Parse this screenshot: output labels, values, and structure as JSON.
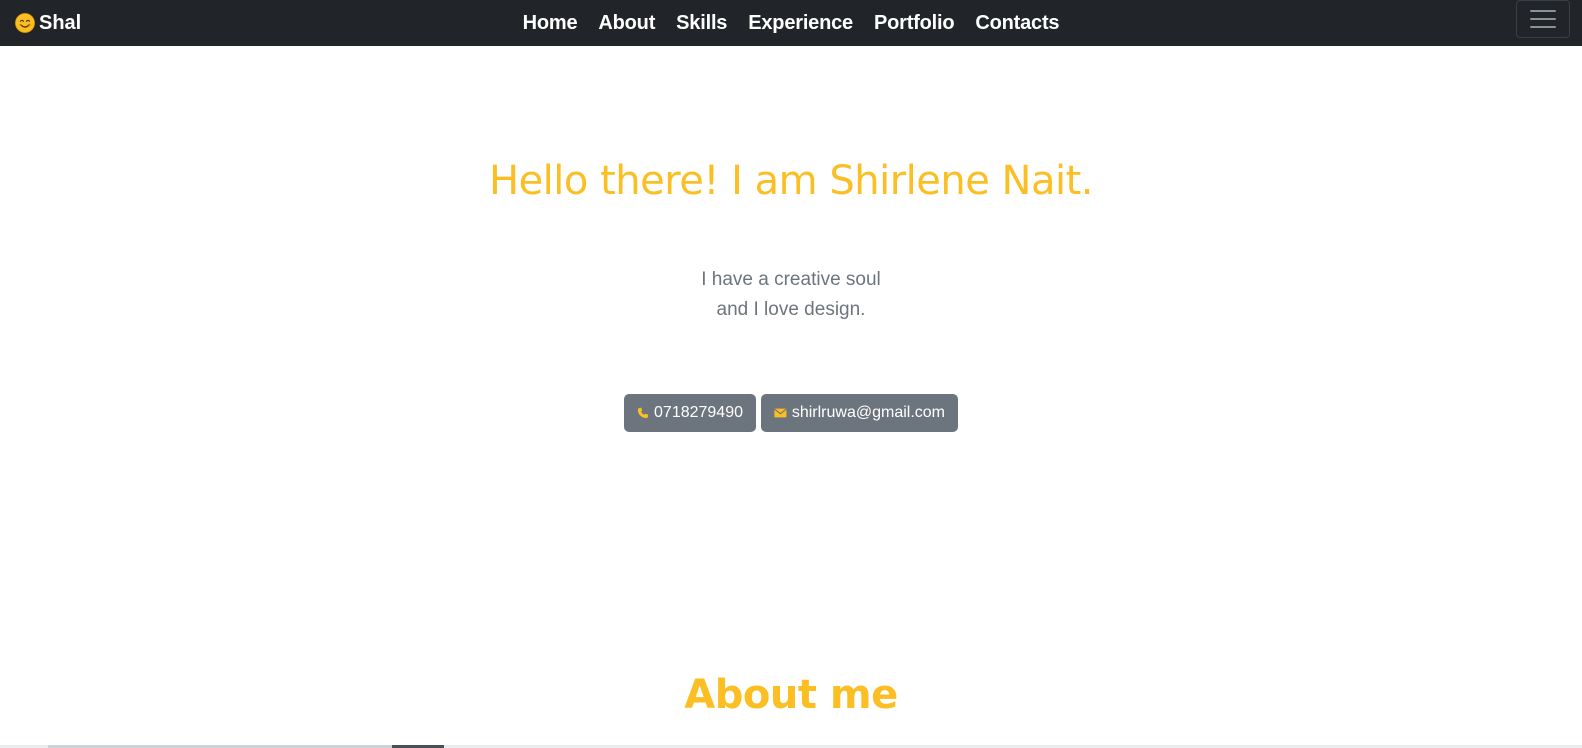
{
  "navbar": {
    "brand_label": "Shal",
    "brand_icon": "smiling-face-emoji",
    "links": [
      "Home",
      "About",
      "Skills",
      "Experience",
      "Portfolio",
      "Contacts"
    ],
    "toggler_icon": "hamburger-menu-icon"
  },
  "hero": {
    "title": "Hello there! I am Shirlene Nait.",
    "tagline_line1": "I have a creative soul",
    "tagline_line2": "and I love design.",
    "phone_label": "0718279490",
    "phone_icon": "phone-icon",
    "email_label": "shirlruwa@gmail.com",
    "email_icon": "envelope-icon"
  },
  "about": {
    "title": "About me"
  },
  "colors": {
    "accent": "#fbbf24",
    "navbar_bg": "#212529",
    "button_bg": "#6c757d",
    "muted_text": "#6c757d"
  }
}
